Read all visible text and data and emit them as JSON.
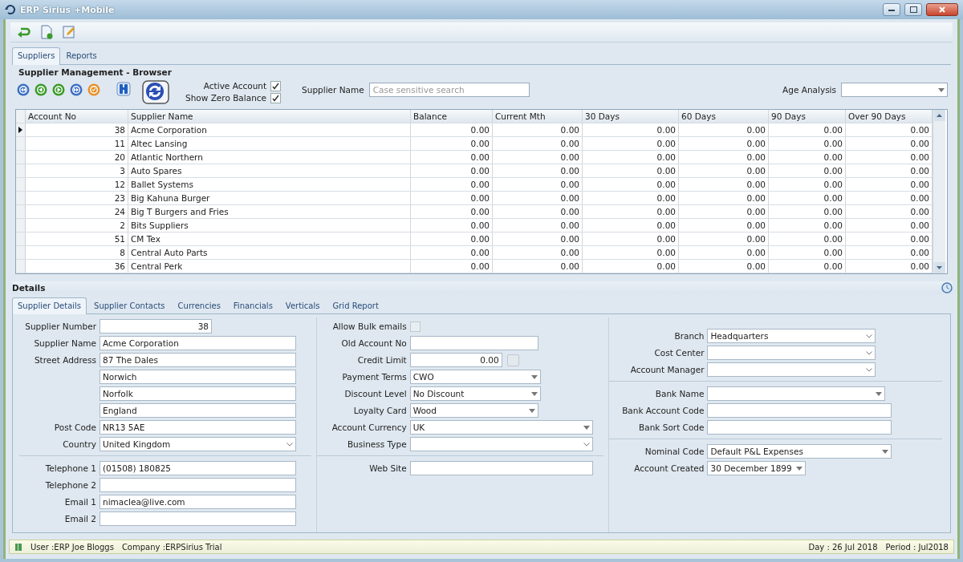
{
  "window": {
    "title": "ERP Sirius +Mobile"
  },
  "main_tabs": [
    {
      "label": "Suppliers",
      "selected": true
    },
    {
      "label": "Reports",
      "selected": false
    }
  ],
  "browser": {
    "title": "Supplier Management - Browser",
    "filters": [
      {
        "label": "Active Account",
        "checked": true
      },
      {
        "label": "Show Zero Balance",
        "checked": true
      }
    ],
    "search": {
      "label": "Supplier Name",
      "placeholder": "Case sensitive search"
    },
    "age_analysis": {
      "label": "Age Analysis"
    }
  },
  "table": {
    "columns": [
      "Account No",
      "Supplier Name",
      "Balance",
      "Current Mth",
      "30 Days",
      "60 Days",
      "90 Days",
      "Over 90 Days"
    ],
    "rows": [
      {
        "selected": true,
        "cells": [
          "38",
          "Acme Corporation",
          "0.00",
          "0.00",
          "0.00",
          "0.00",
          "0.00",
          "0.00"
        ]
      },
      {
        "selected": false,
        "cells": [
          "11",
          "Altec Lansing",
          "0.00",
          "0.00",
          "0.00",
          "0.00",
          "0.00",
          "0.00"
        ]
      },
      {
        "selected": false,
        "cells": [
          "20",
          "Atlantic Northern",
          "0.00",
          "0.00",
          "0.00",
          "0.00",
          "0.00",
          "0.00"
        ]
      },
      {
        "selected": false,
        "cells": [
          "3",
          "Auto Spares",
          "0.00",
          "0.00",
          "0.00",
          "0.00",
          "0.00",
          "0.00"
        ]
      },
      {
        "selected": false,
        "cells": [
          "12",
          "Ballet Systems",
          "0.00",
          "0.00",
          "0.00",
          "0.00",
          "0.00",
          "0.00"
        ]
      },
      {
        "selected": false,
        "cells": [
          "23",
          "Big Kahuna Burger",
          "0.00",
          "0.00",
          "0.00",
          "0.00",
          "0.00",
          "0.00"
        ]
      },
      {
        "selected": false,
        "cells": [
          "24",
          "Big T Burgers and Fries",
          "0.00",
          "0.00",
          "0.00",
          "0.00",
          "0.00",
          "0.00"
        ]
      },
      {
        "selected": false,
        "cells": [
          "2",
          "Bits Suppliers",
          "0.00",
          "0.00",
          "0.00",
          "0.00",
          "0.00",
          "0.00"
        ]
      },
      {
        "selected": false,
        "cells": [
          "51",
          "CM Tex",
          "0.00",
          "0.00",
          "0.00",
          "0.00",
          "0.00",
          "0.00"
        ]
      },
      {
        "selected": false,
        "cells": [
          "8",
          "Central Auto Parts",
          "0.00",
          "0.00",
          "0.00",
          "0.00",
          "0.00",
          "0.00"
        ]
      },
      {
        "selected": false,
        "cells": [
          "36",
          "Central Perk",
          "0.00",
          "0.00",
          "0.00",
          "0.00",
          "0.00",
          "0.00"
        ]
      }
    ]
  },
  "details": {
    "title": "Details",
    "tabs": [
      {
        "label": "Supplier Details",
        "selected": true
      },
      {
        "label": "Supplier Contacts",
        "selected": false
      },
      {
        "label": "Currencies",
        "selected": false
      },
      {
        "label": "Financials",
        "selected": false
      },
      {
        "label": "Verticals",
        "selected": false
      },
      {
        "label": "Grid Report",
        "selected": false
      }
    ],
    "columns": [
      [
        [
          {
            "kind": "number",
            "label": "Supplier Number",
            "value": "38"
          },
          {
            "kind": "text",
            "label": "Supplier Name",
            "value": "Acme Corporation"
          },
          {
            "kind": "text",
            "label": "Street Address",
            "value": "87 The Dales"
          },
          {
            "kind": "text",
            "value": "Norwich"
          },
          {
            "kind": "text",
            "value": "Norfolk"
          },
          {
            "kind": "text",
            "value": "England"
          },
          {
            "kind": "text",
            "label": "Post Code",
            "value": "NR13 5AE"
          },
          {
            "kind": "combo",
            "label": "Country",
            "value": "United Kingdom"
          }
        ],
        [
          {
            "kind": "text",
            "label": "Telephone 1",
            "value": "(01508) 180825"
          },
          {
            "kind": "text",
            "label": "Telephone 2"
          },
          {
            "kind": "text",
            "label": "Email 1",
            "value": "nimaclea@live.com"
          },
          {
            "kind": "text",
            "label": "Email 2"
          }
        ]
      ],
      [
        [
          {
            "kind": "checkbox",
            "label": "Allow Bulk emails",
            "checked": false
          },
          {
            "kind": "text",
            "label": "Old Account No"
          },
          {
            "kind": "credit",
            "label": "Credit Limit",
            "value": "0.00"
          },
          {
            "kind": "dropdown",
            "label": "Payment Terms",
            "value": "CWO"
          },
          {
            "kind": "dropdown",
            "label": "Discount Level",
            "value": "No Discount"
          },
          {
            "kind": "dropdown",
            "label": "Loyalty Card",
            "value": "Wood"
          },
          {
            "kind": "dropdown",
            "label": "Account Currency",
            "value": "UK"
          },
          {
            "kind": "combo",
            "label": "Business Type"
          }
        ],
        [
          {
            "kind": "text",
            "label": "Web Site"
          }
        ]
      ],
      [
        [
          {
            "kind": "combo",
            "label": "Branch",
            "value": "Headquarters"
          },
          {
            "kind": "combo",
            "label": "Cost Center"
          },
          {
            "kind": "combo",
            "label": "Account Manager"
          }
        ],
        [
          {
            "kind": "dropdown",
            "label": "Bank Name"
          },
          {
            "kind": "text",
            "label": "Bank Account Code"
          },
          {
            "kind": "text",
            "label": "Bank Sort Code"
          }
        ],
        [
          {
            "kind": "dropdown",
            "label": "Nominal Code",
            "value": "Default P&L Expenses"
          },
          {
            "kind": "dropdown",
            "label": "Account Created",
            "value": "30 December 1899"
          }
        ]
      ]
    ]
  },
  "status_bar": {
    "user": "User :ERP Joe Bloggs",
    "company": "Company :ERPSirius Trial",
    "day": "Day : 26 Jul 2018",
    "period": "Period : Jul2018"
  }
}
